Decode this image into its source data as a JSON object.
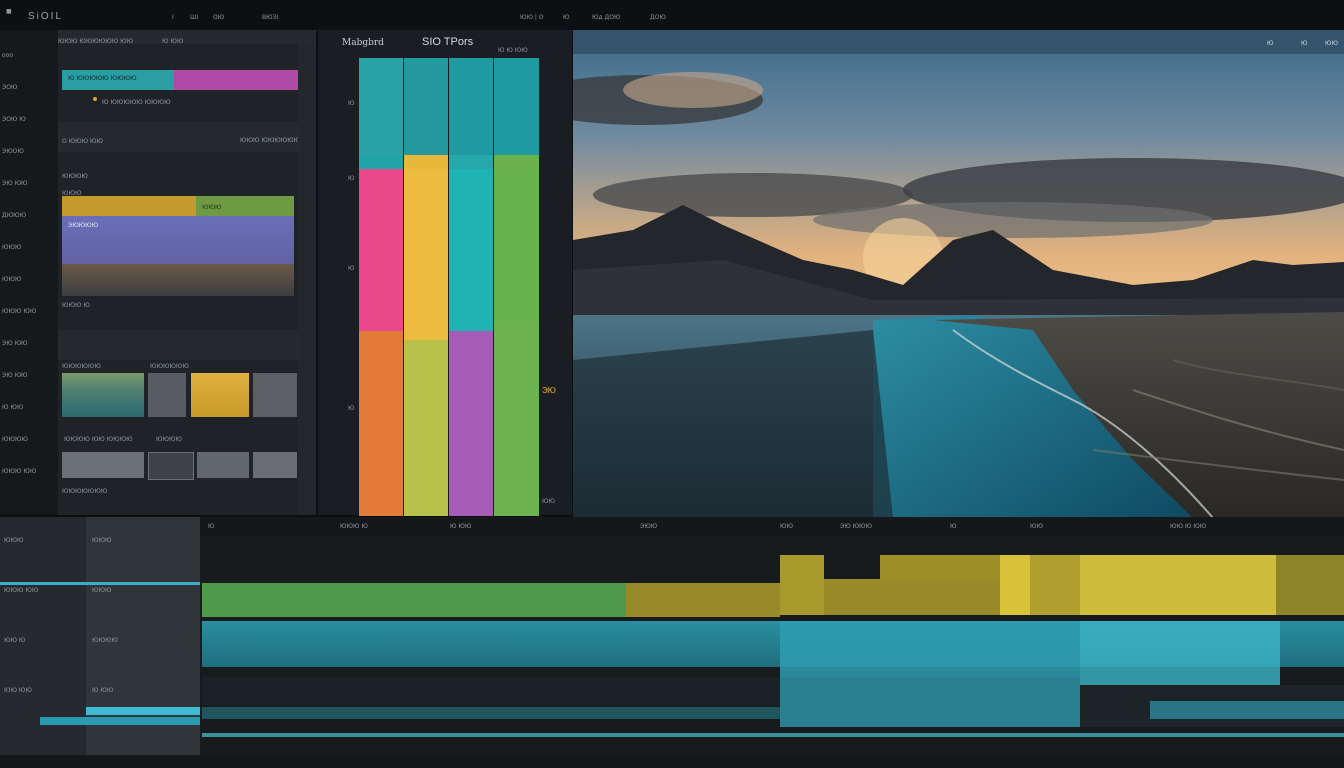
{
  "topbar": {
    "app_title": "SiOIL",
    "menu_items": [
      "I",
      "ШI",
      "ОЮ",
      "BЮЗI"
    ],
    "center_items": [
      "ЮЮ | О",
      "Ю",
      "Юд ДОЮ",
      "ДОЮ"
    ],
    "right_items": [
      "ЮЮЮ",
      "ЮЮ"
    ]
  },
  "left_panel": {
    "items": [
      "ooo",
      "ЭОЮ",
      "ЭОЮ Ю",
      "ЭЮОЮ",
      "ЭЮ ЮЮ",
      "ДЮЮЮ",
      "ЮЮЮ",
      "ЮЮЮ",
      "ЮЮЮ ЮЮ",
      "ЭЮ ЮЮ",
      "ЭЮ ЮЮ",
      "Ю ЮЮ",
      "ЮЮЮЮ",
      "ЮЮЮ ЮЮ"
    ]
  },
  "main_panel": {
    "header_left": "ЮЮЮ ЮЮЮЮЮЮ ЮЮ",
    "row1_label": "Ю ЮЮЮЮЮ ЮЮЮЮ",
    "row2_left": "О ЮЮЮ ЮЮ",
    "row2_right": "ЮЮЮ ЮЮЮЮЮЮЮ",
    "section_label": "ЮЮЮЮ",
    "sub_label": "ЮЮЮ",
    "grade_label": "ЮЮЮ",
    "clip_label": "ЭЮЮЮЮ",
    "media_label": "ЮЮЮЮЮЮ",
    "media_caption": "ЮЮЮЮ ЮЮ ЮЮЮЮ",
    "bottom_label": "ЮЮЮЮЮЮЮ"
  },
  "color_panel": {
    "title": "Mabgbrd",
    "subtitle": "SIO TPors",
    "menu": "Ю Ю ЮЮ",
    "side_marker": "ЭЮ",
    "bottom_marker": "ЮЮ"
  },
  "viewer": {
    "right_controls": [
      "Ю",
      "Ю",
      "ЮЮ"
    ]
  },
  "timeline": {
    "header_items": [
      "Ю",
      "ЮЮЮ Ю",
      "Ю ЮЮ",
      "ЭЮЮ",
      "ЮЮ",
      "ЭЮ ЮЮЮ",
      "Ю",
      "ЮЮ",
      "ЮЮ Ю ЮЮ"
    ],
    "track_labels": [
      "ЮЮЮ",
      "ЮЮЮ",
      "ЮЮЮ ЮЮ",
      "ЮЮЮ",
      "ЮЮ Ю",
      "ЮЮЮЮ",
      "ЮЮ ЮЮ",
      "Ю ЮЮ"
    ]
  },
  "colors": {
    "teal": "#2aa3a7",
    "pink": "#e9488a",
    "yellow": "#e9b83b",
    "orange": "#e27a3a",
    "green": "#67b24d",
    "purple": "#a65bb6",
    "olive": "#a89a2c",
    "gold": "#d7c23a"
  }
}
